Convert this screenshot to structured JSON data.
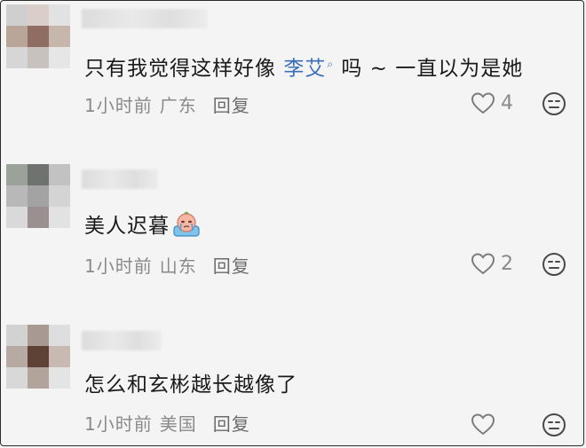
{
  "comments": [
    {
      "text_before": "只有我觉得这样好像 ",
      "mention": "李艾",
      "text_after": " 吗 ~ 一直以为是她",
      "time": "1小时前",
      "location": "广东",
      "reply_label": "回复",
      "like_count": "4",
      "avatar_colors": [
        "#cfcfcf",
        "#d9cfc8",
        "#e2e2e2",
        "#b9a699",
        "#8f6d62",
        "#c7b6ab",
        "#d6d6d6",
        "#c9c2bc",
        "#e6e6e6"
      ]
    },
    {
      "text": "美人迟暮",
      "sticker": "crying-face-sticker",
      "time": "1小时前",
      "location": "山东",
      "reply_label": "回复",
      "like_count": "2",
      "avatar_colors": [
        "#9aa29a",
        "#6f736f",
        "#c2c2c2",
        "#b8b8b8",
        "#a3a3a3",
        "#d4d4d4",
        "#d9d9d9",
        "#9a9090",
        "#e2e2e2"
      ]
    },
    {
      "text": "怎么和玄彬越长越像了",
      "time": "1小时前",
      "location": "美国",
      "reply_label": "回复",
      "like_count": "",
      "avatar_colors": [
        "#d2d2d2",
        "#a89a93",
        "#dedede",
        "#b7aaa3",
        "#5e4236",
        "#c8bab2",
        "#d8d8d8",
        "#b3a49b",
        "#e4e4e4"
      ]
    }
  ],
  "icons": {
    "like": "heart-outline-icon",
    "emoji": "emoji-face-icon"
  },
  "colors": {
    "background": "#f4f4f4",
    "text": "#1a1a1a",
    "meta": "#8a8a8a",
    "mention": "#3d6fb6"
  }
}
